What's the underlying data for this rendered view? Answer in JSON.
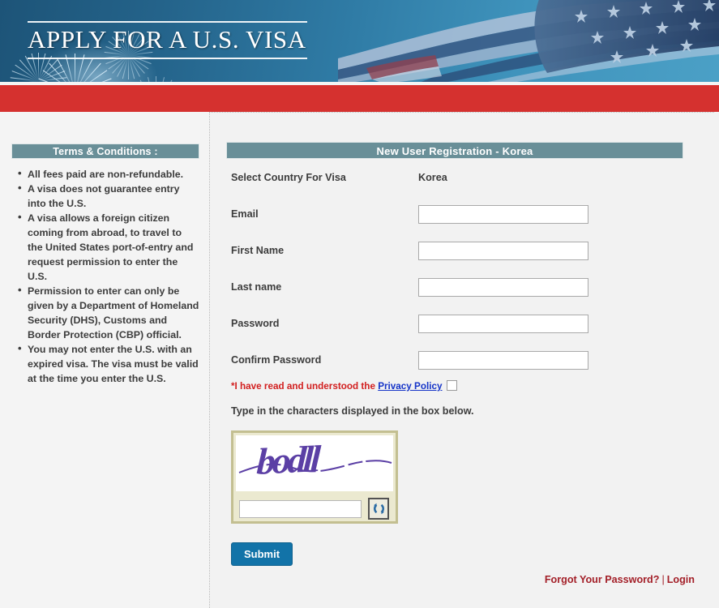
{
  "banner": {
    "title": "APPLY FOR A U.S. VISA",
    "flag_icon": "us-flag",
    "fireworks_icon": "fireworks",
    "gradient_from": "#1d5478",
    "gradient_to": "#4ba0c6",
    "accent_bar_color": "#d5312f"
  },
  "sidebar": {
    "title": "Terms & Conditions :",
    "items": [
      "All fees paid are non-refundable.",
      "A visa does not guarantee entry into the U.S.",
      "A visa allows a foreign citizen coming from abroad, to travel to the United States port-of-entry and request permission to enter the U.S.",
      "Permission to enter can only be given by a Department of Homeland Security (DHS), Customs and Border Protection (CBP) official.",
      "You may not enter the U.S. with an expired visa. The visa must be valid at the time you enter the U.S."
    ]
  },
  "main": {
    "panel_title": "New User Registration - Korea",
    "country_label": "Select Country For Visa",
    "country_value": "Korea",
    "fields": [
      {
        "label": "Email",
        "value": "",
        "placeholder": ""
      },
      {
        "label": "First Name",
        "value": "",
        "placeholder": ""
      },
      {
        "label": "Last name",
        "value": "",
        "placeholder": ""
      },
      {
        "label": "Password",
        "value": "",
        "placeholder": ""
      },
      {
        "label": "Confirm Password",
        "value": "",
        "placeholder": ""
      }
    ],
    "privacy": {
      "text_before": "*I have read and understood the ",
      "link_label": "Privacy Policy",
      "checked": false,
      "text_color": "#d21f1f",
      "link_color": "#1534c8"
    },
    "captcha": {
      "instruction": "Type in the characters displayed in the box below.",
      "challenge_text": "bodll",
      "input_value": "",
      "input_placeholder": "",
      "refresh_icon": "refresh-icon",
      "border_color": "#c3bf91",
      "text_color": "#5b3fa5"
    },
    "submit_label": "Submit",
    "footer": {
      "forgot_label": "Forgot Your Password?",
      "separator": "|",
      "login_label": "Login",
      "link_color": "#a31f28"
    }
  },
  "theme": {
    "panel_header_color": "#698f98",
    "page_background": "#f4f4f4",
    "submit_color": "#1273a8"
  }
}
